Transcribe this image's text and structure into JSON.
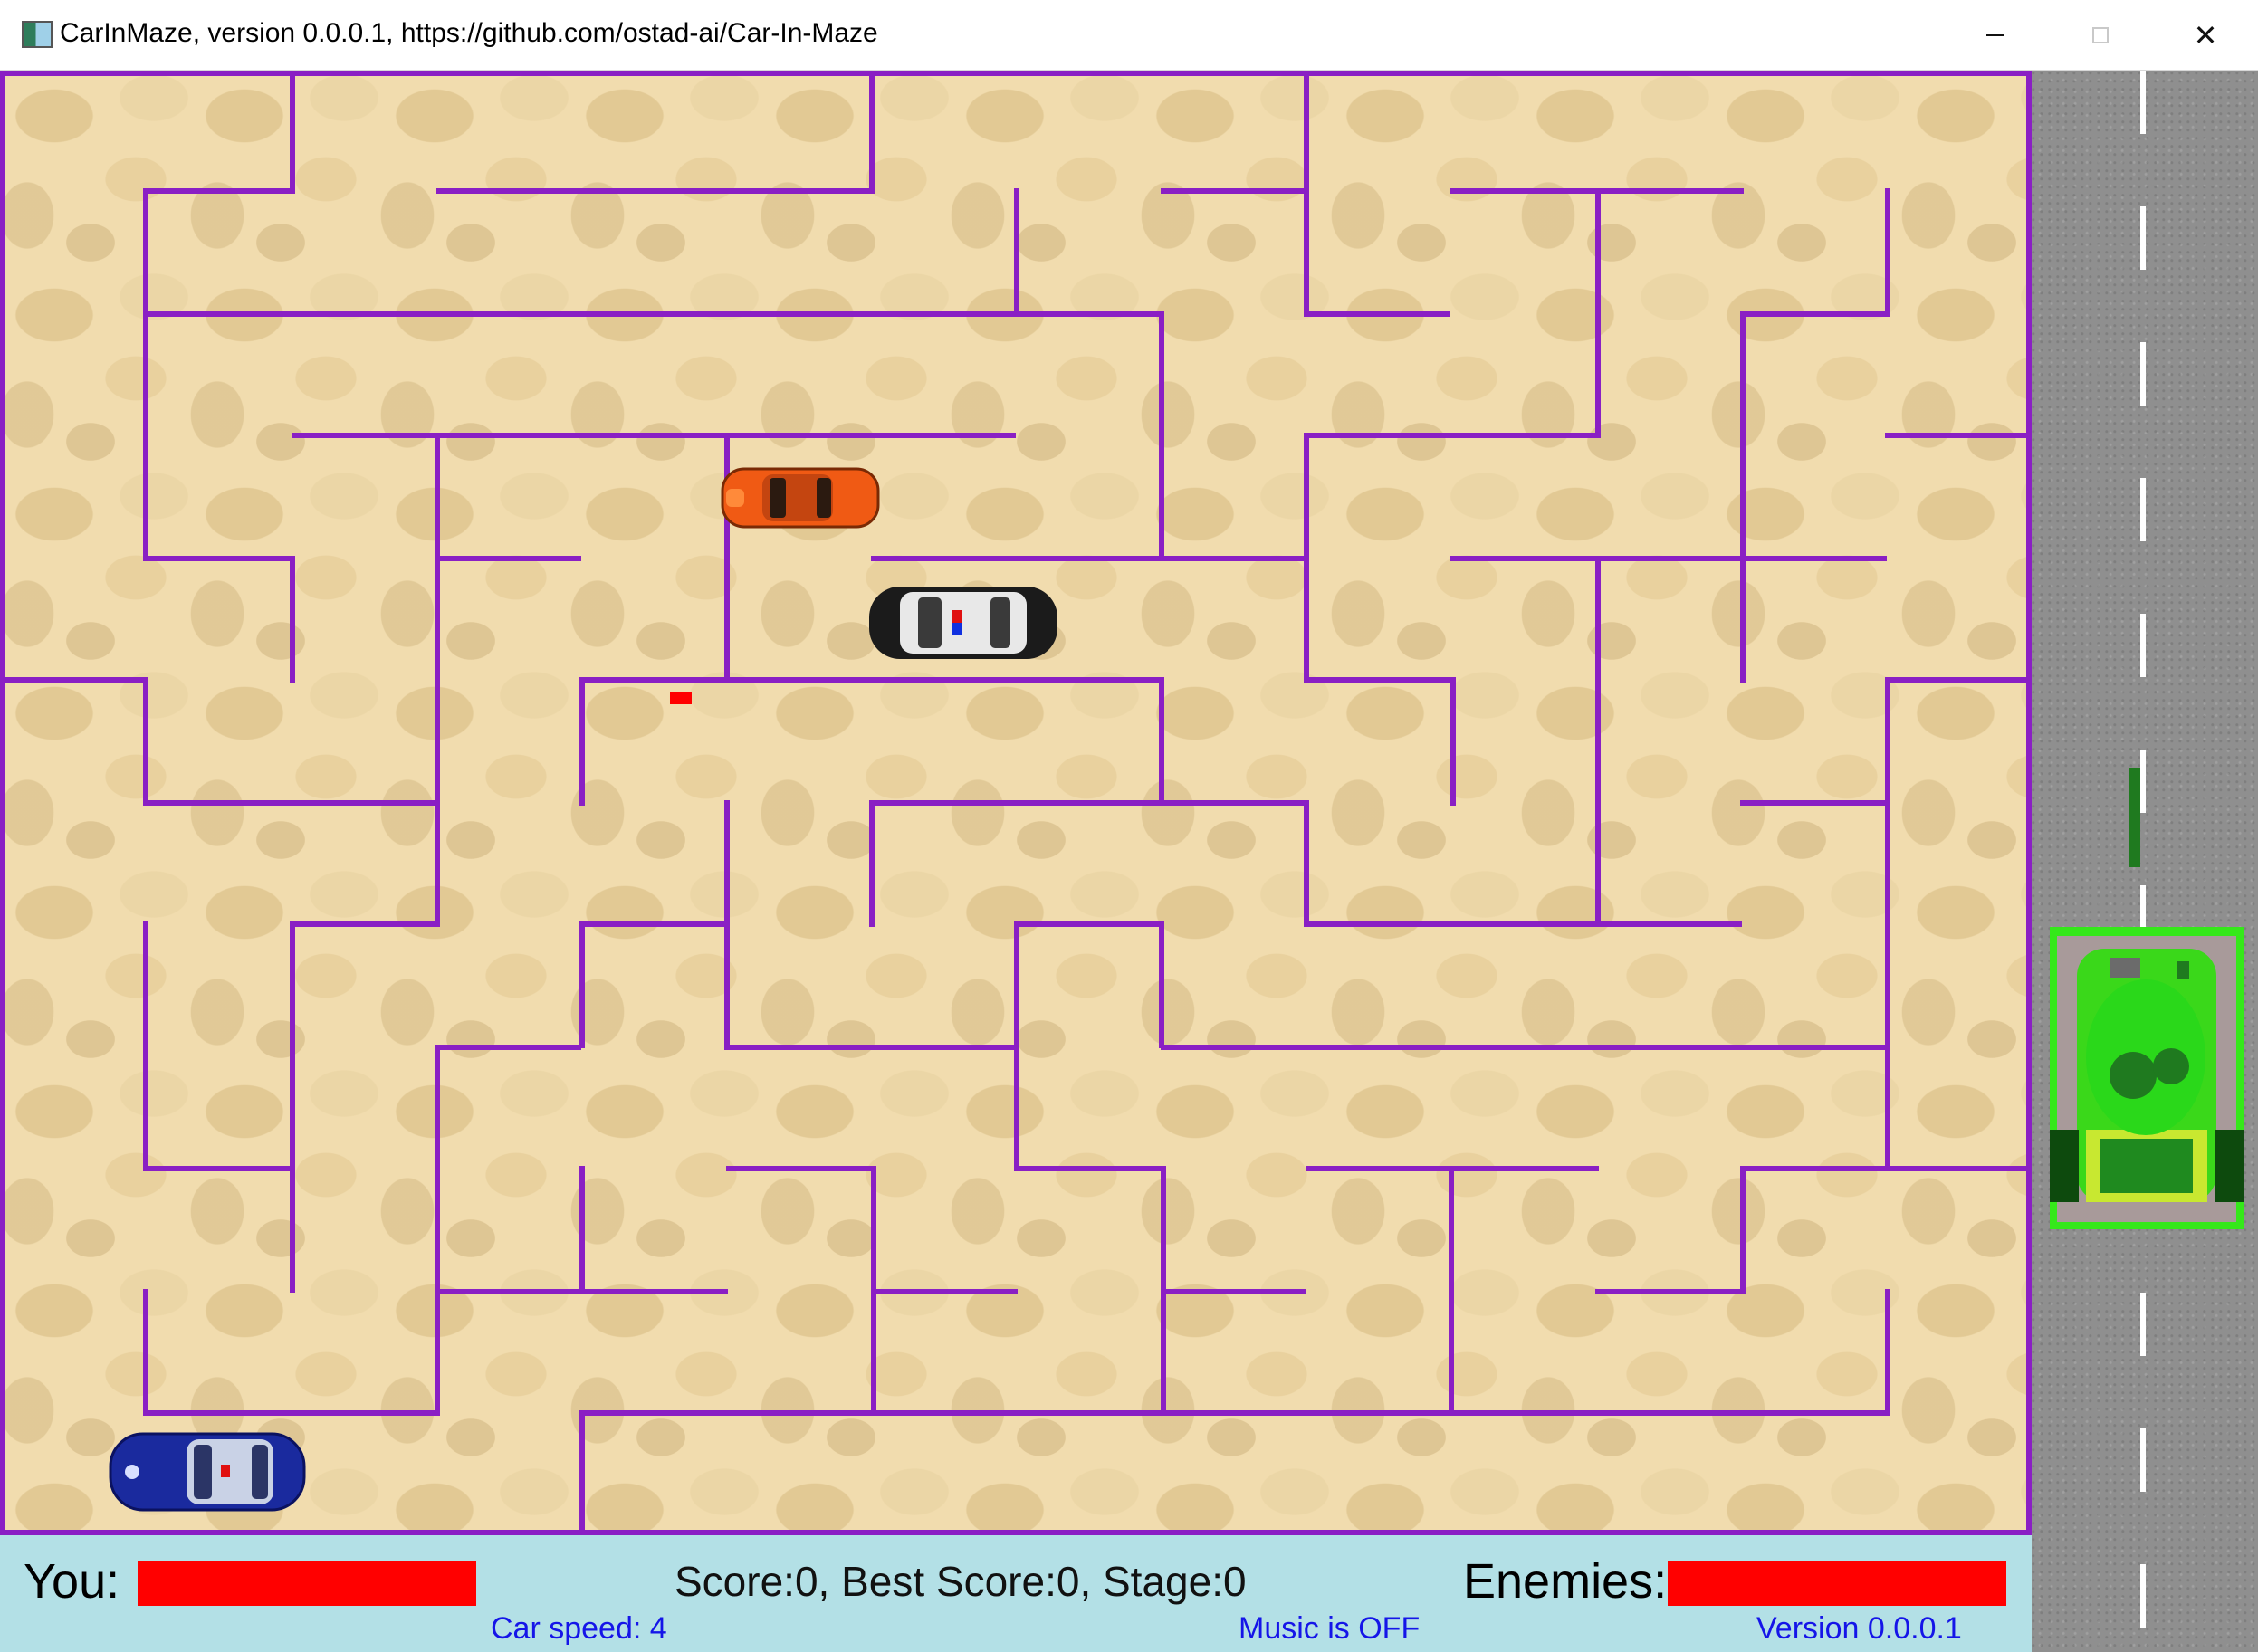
{
  "window": {
    "title": "CarInMaze, version 0.0.0.1, https://github.com/ostad-ai/Car-In-Maze",
    "app_icon": "app-window-icon",
    "minimize_icon": "minimize-icon",
    "maximize_icon": "maximize-icon",
    "close_icon": "close-icon",
    "close_glyph": "✕"
  },
  "game": {
    "wall_color": "#8a1fc4",
    "laser_color": "#ff0000",
    "cars": [
      {
        "name": "orange-sports-car",
        "color": "#f05a14"
      },
      {
        "name": "police-car",
        "color": "#e8e8e8"
      },
      {
        "name": "player-blue-car",
        "color": "#1a2a9e"
      }
    ],
    "tank": {
      "name": "green-tank",
      "color": "#35e81a"
    }
  },
  "status": {
    "you_label": "You:",
    "enemies_label": "Enemies:",
    "you_health": 1.0,
    "enemies_health": 1.0,
    "health_color": "#ff0000",
    "score_text": "Score:0, Best Score:0, Stage:0",
    "car_speed": "Car speed: 4",
    "music": "Music is OFF",
    "version": "Version 0.0.0.1",
    "background": "#b3e0e6",
    "info_color": "#1515e8"
  }
}
